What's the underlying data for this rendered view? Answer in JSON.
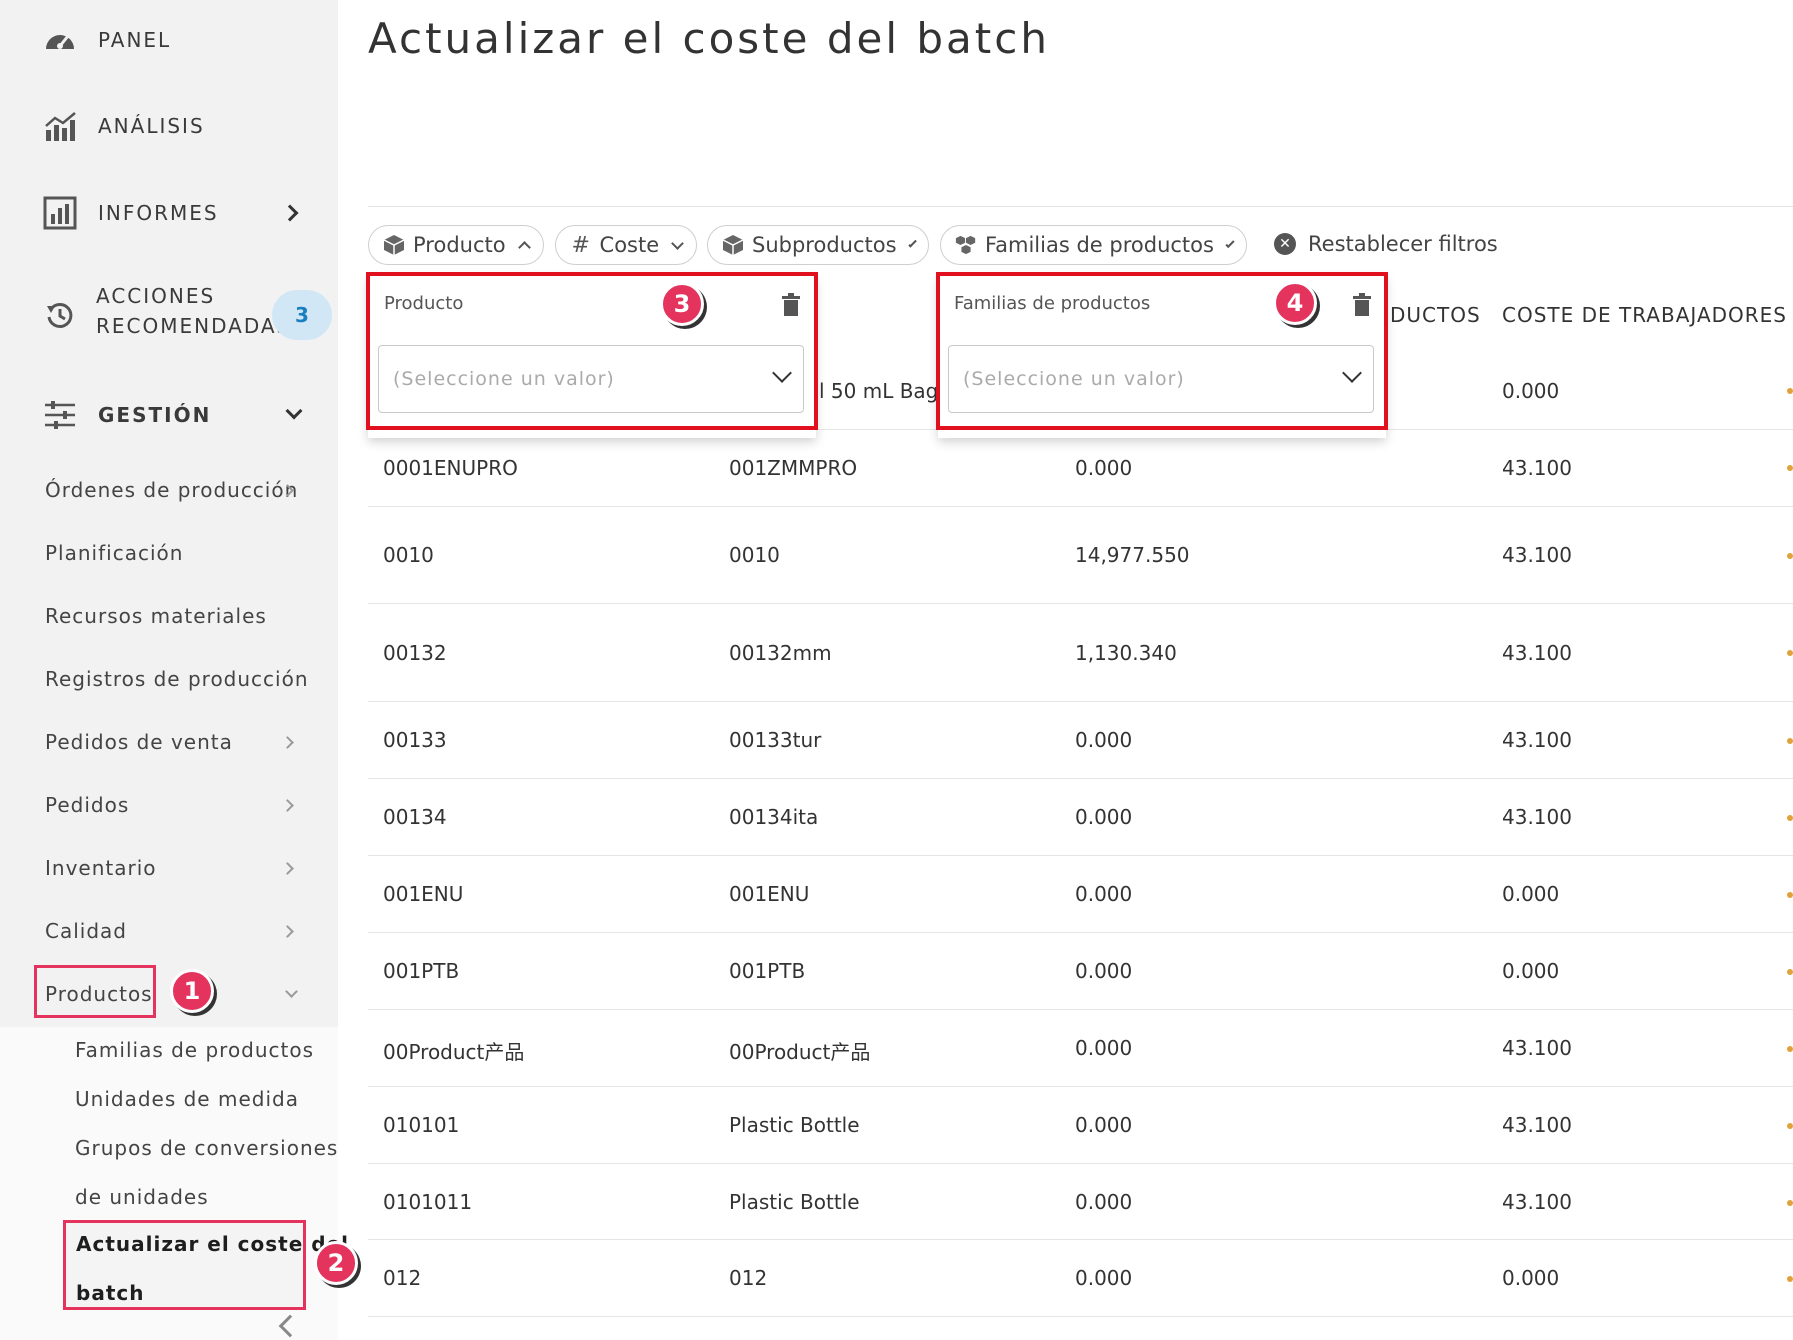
{
  "page": {
    "title": "Actualizar el coste del batch"
  },
  "sidebar": {
    "panel": "PANEL",
    "analisis": "ANÁLISIS",
    "informes": "INFORMES",
    "acciones_line1": "ACCIONES",
    "acciones_line2": "RECOMENDADAS",
    "acciones_badge": "3",
    "gestion": "GESTIÓN",
    "items": [
      "Órdenes de producción",
      "Planificación",
      "Recursos materiales",
      "Registros de producción",
      "Pedidos de venta",
      "Pedidos",
      "Inventario",
      "Calidad",
      "Productos"
    ],
    "productos_sub": [
      "Familias de productos",
      "Unidades de medida",
      "Grupos de conversiones",
      "de unidades"
    ],
    "active_line1": "Actualizar el coste del",
    "active_line2": "batch"
  },
  "callouts": [
    "1",
    "2",
    "3",
    "4"
  ],
  "filters": {
    "chips": [
      "Producto",
      "Coste",
      "Subproductos",
      "Familias de productos"
    ],
    "reset": "Restablecer filtros"
  },
  "popover_producto": {
    "label": "Producto",
    "placeholder": "(Seleccione un valor)"
  },
  "popover_familias": {
    "label": "Familias de productos",
    "placeholder": "(Seleccione un valor)"
  },
  "table": {
    "headers": {
      "subproductos_partial": "DUCTOS",
      "coste_trabajadores": "COSTE DE TRABAJADORES"
    },
    "first_row": {
      "col2_partial": "l 50 mL Bag",
      "col4": "0.000"
    },
    "rows": [
      [
        "0001ENUPRO",
        "001ZMMPRO",
        "0.000",
        "43.100"
      ],
      [
        "0010",
        "0010",
        "14,977.550",
        "43.100"
      ],
      [
        "00132",
        "00132mm",
        "1,130.340",
        "43.100"
      ],
      [
        "00133",
        "00133tur",
        "0.000",
        "43.100"
      ],
      [
        "00134",
        "00134ita",
        "0.000",
        "43.100"
      ],
      [
        "001ENU",
        "001ENU",
        "0.000",
        "0.000"
      ],
      [
        "001PTB",
        "001PTB",
        "0.000",
        "0.000"
      ],
      [
        "00Product产品",
        "00Product产品",
        "0.000",
        "43.100"
      ],
      [
        "010101",
        "Plastic Bottle",
        "0.000",
        "43.100"
      ],
      [
        "0101011",
        "Plastic Bottle",
        "0.000",
        "43.100"
      ],
      [
        "012",
        "012",
        "0.000",
        "0.000"
      ]
    ]
  }
}
